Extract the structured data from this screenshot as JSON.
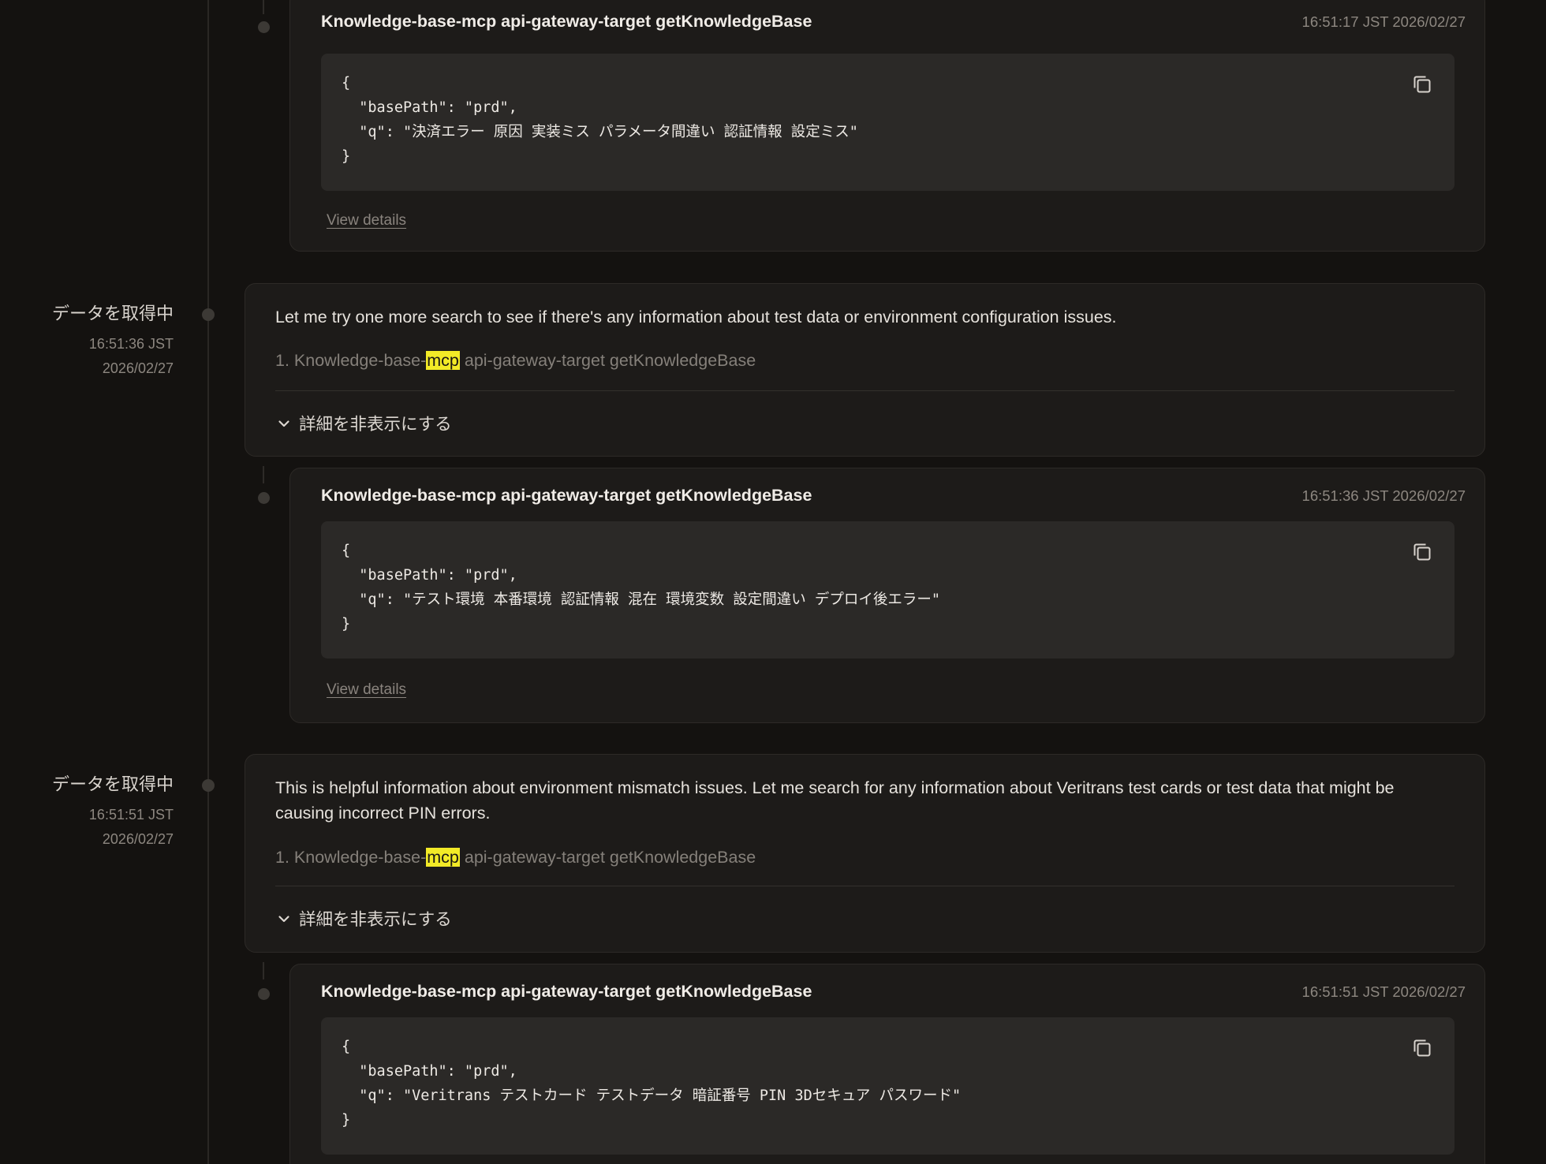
{
  "steps": [
    {
      "status": "データを取得中",
      "time": "16:51:36 JST",
      "date": "2026/02/27",
      "text": "Let me try one more search to see if there's any information about test data or environment configuration issues.",
      "tool_ref": {
        "number": "1.",
        "prefix": "Knowledge-base-",
        "highlight": "mcp",
        "suffix": " api-gateway-target getKnowledgeBase"
      },
      "toggle_label": "詳細を非表示にする"
    },
    {
      "status": "データを取得中",
      "time": "16:51:51 JST",
      "date": "2026/02/27",
      "text": "This is helpful information about environment mismatch issues. Let me search for any information about Veritrans test cards or test data that might be causing incorrect PIN errors.",
      "tool_ref": {
        "number": "1.",
        "prefix": "Knowledge-base-",
        "highlight": "mcp",
        "suffix": " api-gateway-target getKnowledgeBase"
      },
      "toggle_label": "詳細を非表示にする"
    }
  ],
  "tool_calls": [
    {
      "title": "Knowledge-base-mcp api-gateway-target getKnowledgeBase",
      "timestamp": "16:51:17 JST 2026/02/27",
      "code": "{\n  \"basePath\": \"prd\",\n  \"q\": \"決済エラー 原因 実装ミス パラメータ間違い 認証情報 設定ミス\"\n}",
      "view_details": "View details"
    },
    {
      "title": "Knowledge-base-mcp api-gateway-target getKnowledgeBase",
      "timestamp": "16:51:36 JST 2026/02/27",
      "code": "{\n  \"basePath\": \"prd\",\n  \"q\": \"テスト環境 本番環境 認証情報 混在 環境変数 設定間違い デプロイ後エラー\"\n}",
      "view_details": "View details"
    },
    {
      "title": "Knowledge-base-mcp api-gateway-target getKnowledgeBase",
      "timestamp": "16:51:51 JST 2026/02/27",
      "code": "{\n  \"basePath\": \"prd\",\n  \"q\": \"Veritrans テストカード テストデータ 暗証番号 PIN 3Dセキュア パスワード\"\n}",
      "view_details": "View details"
    }
  ],
  "icons": {
    "copy": "copy-icon",
    "chevron": "chevron-down-icon",
    "timeline_dot": "timeline-dot-icon"
  },
  "colors": {
    "background": "#141210",
    "card": "#1d1b19",
    "code_bg": "#2b2927",
    "highlight": "#f2ea27"
  }
}
